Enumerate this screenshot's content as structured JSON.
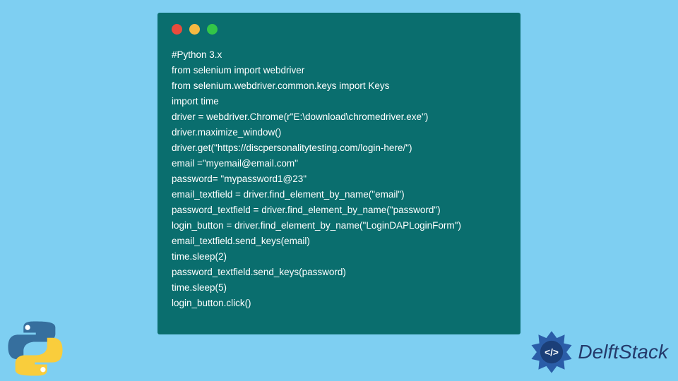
{
  "code": {
    "lines": [
      "#Python 3.x",
      "from selenium import webdriver",
      "from selenium.webdriver.common.keys import Keys",
      "import time",
      "driver = webdriver.Chrome(r\"E:\\download\\chromedriver.exe\")",
      "driver.maximize_window()",
      "driver.get(\"https://discpersonalitytesting.com/login-here/\")",
      "email =\"myemail@email.com\"",
      "password= \"mypassword1@23\"",
      "email_textfield = driver.find_element_by_name(\"email\")",
      "password_textfield = driver.find_element_by_name(\"password\")",
      "login_button = driver.find_element_by_name(\"LoginDAPLoginForm\")",
      "email_textfield.send_keys(email)",
      "time.sleep(2)",
      "password_textfield.send_keys(password)",
      "time.sleep(5)",
      "login_button.click()"
    ]
  },
  "brand": {
    "text": "DelftStack"
  },
  "dots": {
    "red": "#e94b3c",
    "yellow": "#f5b942",
    "green": "#33c648"
  }
}
